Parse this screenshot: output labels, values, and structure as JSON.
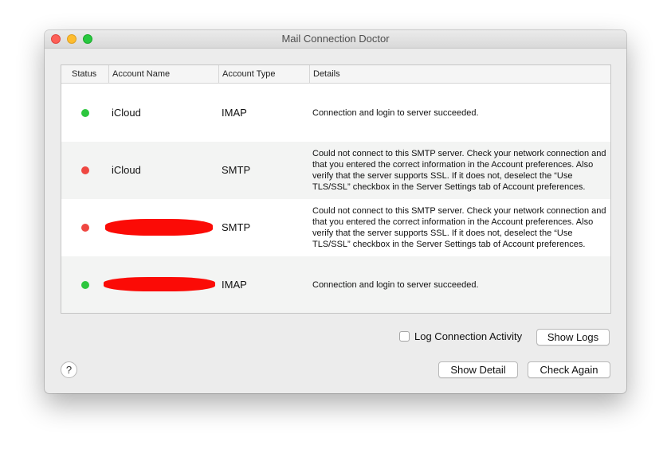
{
  "window": {
    "title": "Mail Connection Doctor"
  },
  "table": {
    "columns": [
      "Status",
      "Account Name",
      "Account Type",
      "Details"
    ],
    "rows": [
      {
        "status": "success",
        "status_color": "#2dc63e",
        "account_name": "iCloud",
        "account_type": "IMAP",
        "details": "Connection and login to server succeeded."
      },
      {
        "status": "failure",
        "status_color": "#ef4741",
        "account_name": "iCloud",
        "account_type": "SMTP",
        "details": "Could not connect to this SMTP server. Check your network connection and that you entered the correct information in the Account preferences. Also verify that the server supports SSL. If it does not, deselect the “Use TLS/SSL” checkbox in the Server Settings tab of Account preferences."
      },
      {
        "status": "failure",
        "status_color": "#ef4741",
        "account_name": "",
        "account_name_redacted": true,
        "account_type": "SMTP",
        "details": "Could not connect to this SMTP server. Check your network connection and that you entered the correct information in the Account preferences. Also verify that the server supports SSL. If it does not, deselect the “Use TLS/SSL” checkbox in the Server Settings tab of Account preferences."
      },
      {
        "status": "success",
        "status_color": "#2dc63e",
        "account_name": "",
        "account_name_redacted": true,
        "account_type": "IMAP",
        "details": "Connection and login to server succeeded."
      }
    ]
  },
  "controls": {
    "log_activity_label": "Log Connection Activity",
    "log_activity_checked": false,
    "show_logs_label": "Show Logs",
    "show_detail_label": "Show Detail",
    "check_again_label": "Check Again",
    "help_label": "?"
  },
  "colors": {
    "redaction": "#fb0b06",
    "window_bg": "#ececec"
  }
}
